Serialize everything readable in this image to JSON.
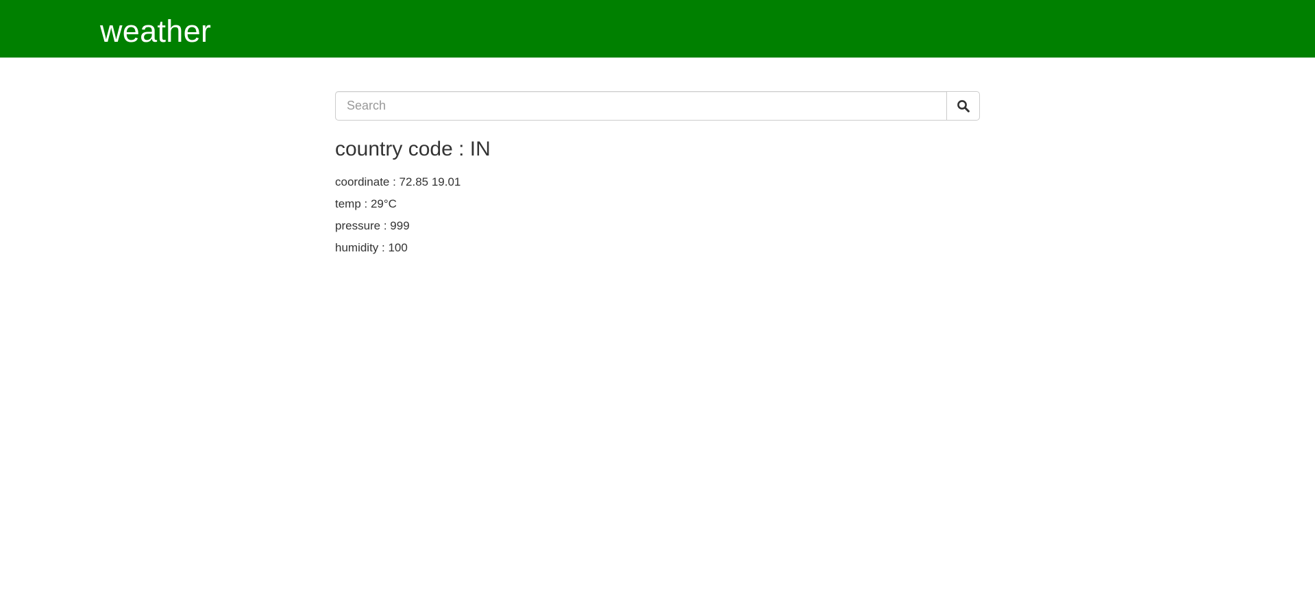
{
  "header": {
    "title": "weather",
    "bg_color": "#008000"
  },
  "search": {
    "placeholder": "Search",
    "value": "",
    "button_icon": "search-icon"
  },
  "result": {
    "country_label": "country code : IN",
    "details": [
      "coordinate : 72.85 19.01",
      "temp : 29°C",
      "pressure : 999",
      "humidity : 100"
    ]
  }
}
